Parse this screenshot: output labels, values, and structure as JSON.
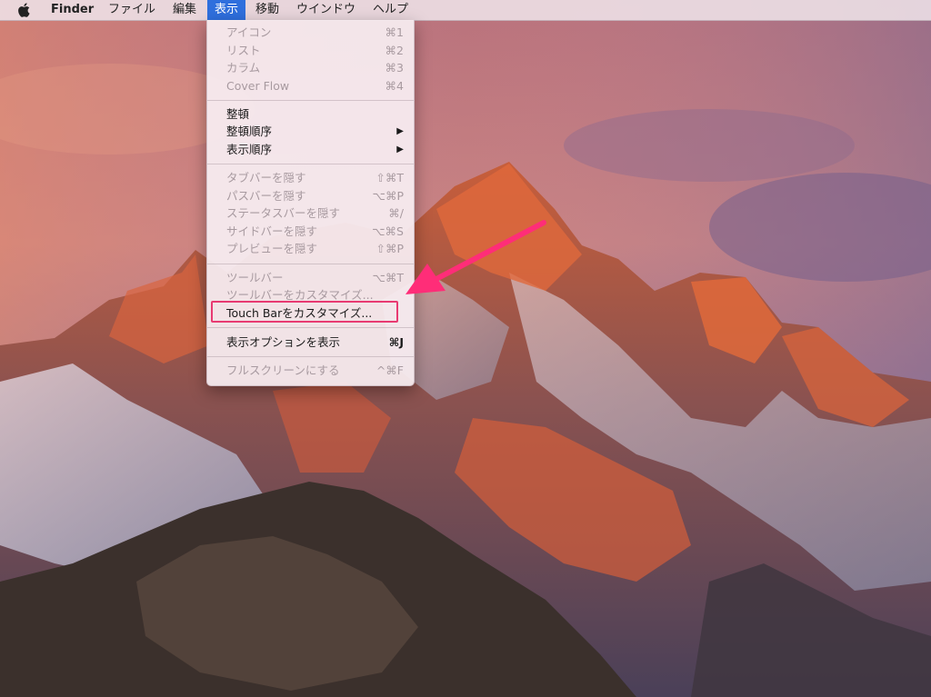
{
  "menubar": {
    "apple_icon": "apple-logo-icon",
    "app_name": "Finder",
    "items": [
      {
        "label": "ファイル"
      },
      {
        "label": "編集"
      },
      {
        "label": "表示"
      },
      {
        "label": "移動"
      },
      {
        "label": "ウインドウ"
      },
      {
        "label": "ヘルプ"
      }
    ]
  },
  "view_menu": {
    "items": [
      {
        "label": "アイコン",
        "shortcut": "⌘1",
        "enabled": false
      },
      {
        "label": "リスト",
        "shortcut": "⌘2",
        "enabled": false
      },
      {
        "label": "カラム",
        "shortcut": "⌘3",
        "enabled": false
      },
      {
        "label": "Cover Flow",
        "shortcut": "⌘4",
        "enabled": false
      },
      {
        "label": "整頓",
        "shortcut": "",
        "enabled": true
      },
      {
        "label": "整頓順序",
        "shortcut": "▶",
        "enabled": true
      },
      {
        "label": "表示順序",
        "shortcut": "▶",
        "enabled": true
      },
      {
        "label": "タブバーを隠す",
        "shortcut": "⇧⌘T",
        "enabled": false
      },
      {
        "label": "パスバーを隠す",
        "shortcut": "⌥⌘P",
        "enabled": false
      },
      {
        "label": "ステータスバーを隠す",
        "shortcut": "⌘/",
        "enabled": false
      },
      {
        "label": "サイドバーを隠す",
        "shortcut": "⌥⌘S",
        "enabled": false
      },
      {
        "label": "プレビューを隠す",
        "shortcut": "⇧⌘P",
        "enabled": false
      },
      {
        "label": "ツールバー",
        "shortcut": "⌥⌘T",
        "enabled": false
      },
      {
        "label": "ツールバーをカスタマイズ...",
        "shortcut": "",
        "enabled": false
      },
      {
        "label": "Touch Barをカスタマイズ...",
        "shortcut": "",
        "enabled": true
      },
      {
        "label": "表示オプションを表示",
        "shortcut": "⌘J",
        "enabled": true
      },
      {
        "label": "フルスクリーンにする",
        "shortcut": "^⌘F",
        "enabled": false
      }
    ]
  },
  "colors": {
    "highlight_box": "#e83a72",
    "arrow": "#ff2d78",
    "menubar_active": "#2f6fdd"
  }
}
